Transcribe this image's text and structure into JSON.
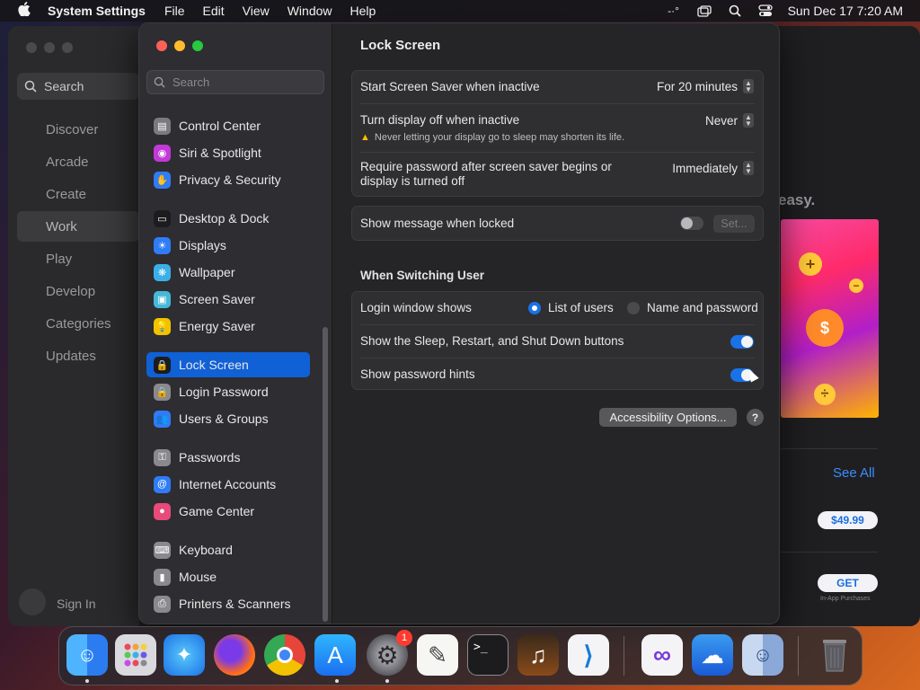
{
  "menubar": {
    "app_name": "System Settings",
    "menus": [
      "File",
      "Edit",
      "View",
      "Window",
      "Help"
    ],
    "clock": "Sun Dec 17  7:20 AM"
  },
  "bg_window": {
    "search_label": "Search",
    "nav": [
      "Discover",
      "Arcade",
      "Create",
      "Work",
      "Play",
      "Develop",
      "Categories",
      "Updates"
    ],
    "selected_nav": "Work",
    "sign_in": "Sign In",
    "headline_fragment": "easy.",
    "see_all": "See All",
    "price": "$49.99",
    "get": "GET",
    "in_app": "In-App Purchases"
  },
  "sidebar": {
    "search_placeholder": "Search",
    "items": [
      {
        "label": "Control Center",
        "icon": "control-center-icon",
        "color": "#7a7a80"
      },
      {
        "label": "Siri & Spotlight",
        "icon": "siri-icon",
        "color": "#c13ad6"
      },
      {
        "label": "Privacy & Security",
        "icon": "hand-icon",
        "color": "#2f7cf6"
      },
      {
        "label": "Desktop & Dock",
        "icon": "desktop-icon",
        "color": "#1c1c1e"
      },
      {
        "label": "Displays",
        "icon": "displays-icon",
        "color": "#2f7cf6"
      },
      {
        "label": "Wallpaper",
        "icon": "wallpaper-icon",
        "color": "#3ab0e8"
      },
      {
        "label": "Screen Saver",
        "icon": "screen-saver-icon",
        "color": "#45b8d8"
      },
      {
        "label": "Energy Saver",
        "icon": "energy-icon",
        "color": "#f2c200"
      },
      {
        "label": "Lock Screen",
        "icon": "lock-icon",
        "color": "#1c1c1e"
      },
      {
        "label": "Login Password",
        "icon": "login-lock-icon",
        "color": "#8a8a8e"
      },
      {
        "label": "Users & Groups",
        "icon": "users-icon",
        "color": "#2f7cf6"
      },
      {
        "label": "Passwords",
        "icon": "key-icon",
        "color": "#8a8a8e"
      },
      {
        "label": "Internet Accounts",
        "icon": "at-icon",
        "color": "#2f7cf6"
      },
      {
        "label": "Game Center",
        "icon": "game-center-icon",
        "color": "#e84a7a"
      },
      {
        "label": "Keyboard",
        "icon": "keyboard-icon",
        "color": "#8a8a8e"
      },
      {
        "label": "Mouse",
        "icon": "mouse-icon",
        "color": "#8a8a8e"
      },
      {
        "label": "Printers & Scanners",
        "icon": "printer-icon",
        "color": "#8a8a8e"
      }
    ],
    "selected": "Lock Screen"
  },
  "main": {
    "title": "Lock Screen",
    "screen_saver": {
      "label": "Start Screen Saver when inactive",
      "value": "For 20 minutes"
    },
    "display_off": {
      "label": "Turn display off when inactive",
      "value": "Never",
      "warning": "Never letting your display go to sleep may shorten its life."
    },
    "require_password": {
      "label_line1": "Require password after screen saver begins or",
      "label_line2": "display is turned off",
      "value": "Immediately"
    },
    "show_message": {
      "label": "Show message when locked",
      "enabled": false,
      "set_button": "Set..."
    },
    "section_switching": "When Switching User",
    "login_window": {
      "label": "Login window shows",
      "options": [
        "List of users",
        "Name and password"
      ],
      "selected": "List of users"
    },
    "show_buttons": {
      "label": "Show the Sleep, Restart, and Shut Down buttons",
      "enabled": true
    },
    "password_hints": {
      "label": "Show password hints",
      "enabled": true
    },
    "accessibility_button": "Accessibility Options...",
    "help": "?"
  },
  "dock": {
    "apps": [
      "Finder",
      "Launchpad",
      "Safari",
      "Firefox",
      "Chrome",
      "App Store",
      "System Settings",
      "TextEdit",
      "Terminal",
      "GarageBand",
      "VS Code",
      "Visual Studio",
      "Weather",
      "Finder Alt",
      "Trash"
    ],
    "settings_badge": "1"
  },
  "colors": {
    "accent": "#1060d6",
    "toggle_on": "#1a72e8",
    "warning": "#f5c000"
  }
}
